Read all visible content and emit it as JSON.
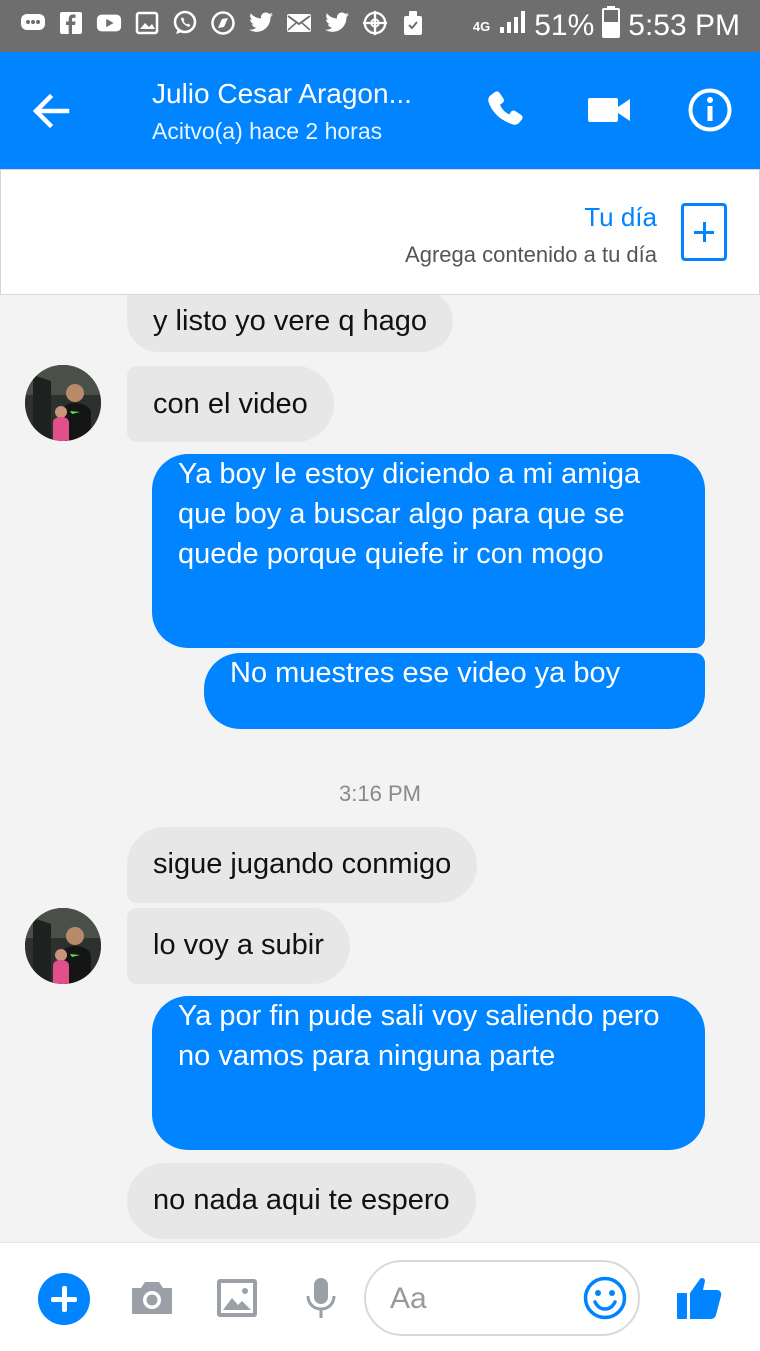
{
  "status_bar": {
    "icons": [
      "messages-icon",
      "facebook-icon",
      "youtube-icon",
      "gallery-icon",
      "whatsapp-icon",
      "browser-icon",
      "twitter-icon",
      "mail-icon",
      "twitter-icon",
      "target-icon",
      "cleaner-icon"
    ],
    "network": "4G",
    "battery": "51%",
    "time": "5:53 PM"
  },
  "header": {
    "contact_name": "Julio Cesar Aragon...",
    "status": "Acitvo(a) hace 2 horas"
  },
  "tu_dia": {
    "title": "Tu día",
    "subtitle": "Agrega contenido a tu día"
  },
  "messages": [
    {
      "sender": "them",
      "text": "y listo yo vere q hago"
    },
    {
      "sender": "them",
      "text": "con el video"
    },
    {
      "sender": "me",
      "text": "Ya boy le estoy diciendo a mi amiga que boy a buscar algo para que se quede porque quiefe ir con mogo"
    },
    {
      "sender": "me",
      "text": "No muestres ese video ya boy"
    },
    {
      "sender": "them",
      "text": "sigue jugando conmigo"
    },
    {
      "sender": "them",
      "text": "lo voy a subir"
    },
    {
      "sender": "me",
      "text": "Ya por fin pude sali voy saliendo pero no vamos para ninguna parte"
    },
    {
      "sender": "them",
      "text": "no nada aqui te espero"
    }
  ],
  "timestamp": "3:16 PM",
  "composer": {
    "placeholder": "Aa"
  },
  "colors": {
    "accent": "#0084ff",
    "incoming_bubble": "#e7e7e7",
    "status_bar": "#6e6e6e"
  }
}
